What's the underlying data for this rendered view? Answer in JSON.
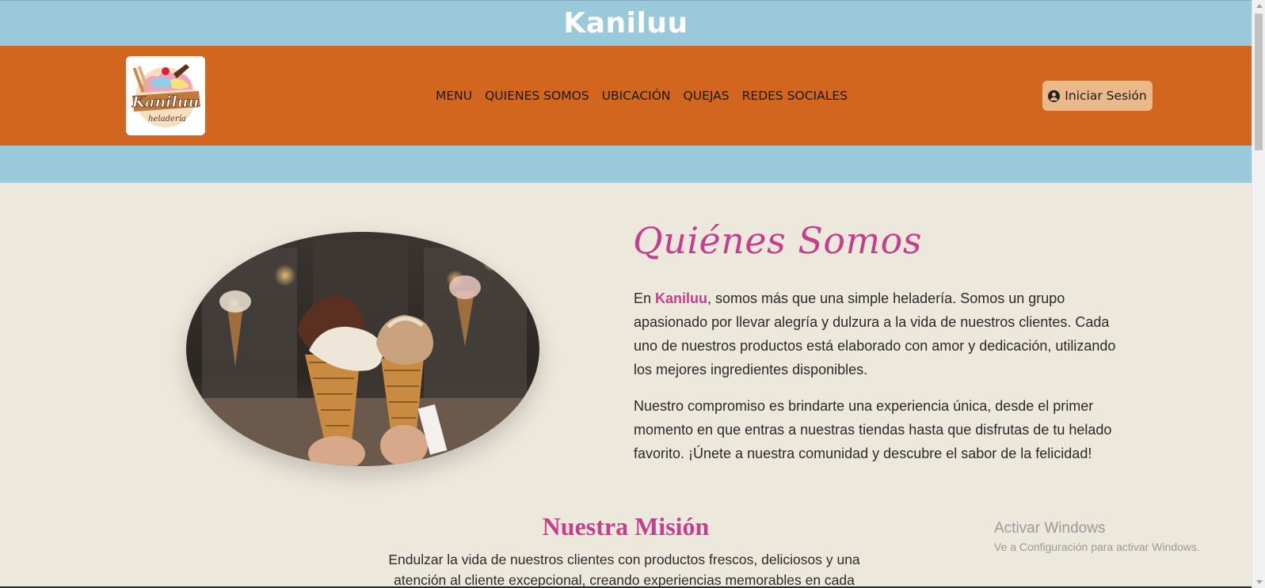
{
  "header": {
    "brand": "Kaniluu"
  },
  "nav": {
    "logo_text": "Kaniluu",
    "logo_subtext": "heladería",
    "links": [
      "MENU",
      "QUIENES SOMOS",
      "UBICACIÓN",
      "QUEJAS",
      "REDES SOCIALES"
    ],
    "login_label": "Iniciar Sesión"
  },
  "about": {
    "title": "Quiénes Somos",
    "p1_prefix": "En ",
    "p1_brand": "Kaniluu",
    "p1_rest": ", somos más que una simple heladería. Somos un grupo apasionado por llevar alegría y dulzura a la vida de nuestros clientes. Cada uno de nuestros productos está elaborado con amor y dedicación, utilizando los mejores ingredientes disponibles.",
    "p2": "Nuestro compromiso es brindarte una experiencia única, desde el primer momento en que entras a nuestras tiendas hasta que disfrutas de tu helado favorito. ¡Únete a nuestra comunidad y descubre el sabor de la felicidad!"
  },
  "mission": {
    "title": "Nuestra Misión",
    "text": "Endulzar la vida de nuestros clientes con productos frescos, deliciosos y una atención al cliente excepcional, creando experiencias memorables en cada"
  },
  "watermark": {
    "line1": "Activar Windows",
    "line2": "Ve a Configuración para activar Windows."
  },
  "colors": {
    "accent_pink": "#c2408f",
    "nav_orange": "#d2661f",
    "header_blue": "#9bc9dc",
    "page_bg": "#ede8dc",
    "button_tan": "#e9b98a"
  }
}
